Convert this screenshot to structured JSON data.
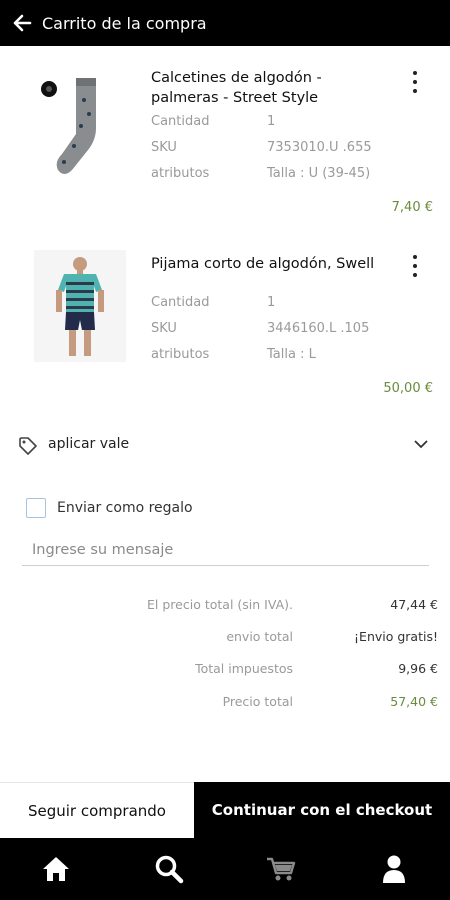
{
  "header": {
    "title": "Carrito de la compra"
  },
  "cart": {
    "items": [
      {
        "title_line1": "Calcetines de algodón -",
        "title_line2": "palmeras - Street Style",
        "attributes": [
          {
            "label": "Cantidad",
            "value": "1"
          },
          {
            "label": "SKU",
            "value": "7353010.U  .655"
          },
          {
            "label": "atributos",
            "value": "Talla : U (39-45)"
          }
        ],
        "price": "7,40 €"
      },
      {
        "title_line1": "Pijama corto de algodón, Swell",
        "title_line2": "",
        "attributes": [
          {
            "label": "Cantidad",
            "value": "1"
          },
          {
            "label": "SKU",
            "value": "3446160.L  .105"
          },
          {
            "label": "atributos",
            "value": "Talla : L"
          }
        ],
        "price": "50,00 €"
      }
    ]
  },
  "voucher": {
    "label": "aplicar vale"
  },
  "gift": {
    "label": "Enviar como regalo",
    "checked": false,
    "message_placeholder": "Ingrese su mensaje"
  },
  "summary": [
    {
      "label": "El precio total (sin IVA).",
      "value": "47,44 €"
    },
    {
      "label": "envio total",
      "value": "¡Envio gratis!"
    },
    {
      "label": "Total impuestos",
      "value": "9,96 €"
    },
    {
      "label": "Precio total",
      "value": "57,40 €"
    }
  ],
  "actions": {
    "continue_shopping": "Seguir comprando",
    "checkout": "Continuar con el checkout"
  },
  "bottom_nav": [
    {
      "icon": "home-icon"
    },
    {
      "icon": "search-icon"
    },
    {
      "icon": "cart-icon"
    },
    {
      "icon": "user-icon"
    }
  ],
  "colors": {
    "header": "#000000",
    "price": "#6b8b3d",
    "checkbox_border": "#a9c4de"
  }
}
